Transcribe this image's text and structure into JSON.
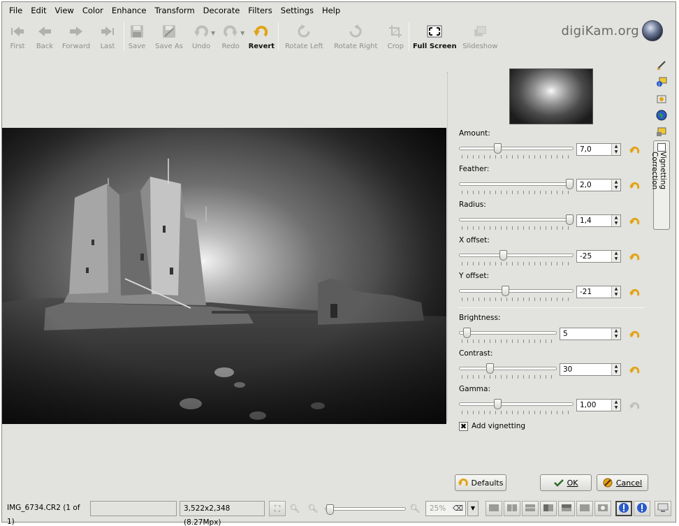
{
  "menu": [
    "File",
    "Edit",
    "View",
    "Color",
    "Enhance",
    "Transform",
    "Decorate",
    "Filters",
    "Settings",
    "Help"
  ],
  "toolbar": {
    "first": "First",
    "back": "Back",
    "forward": "Forward",
    "last": "Last",
    "save": "Save",
    "save_as": "Save As",
    "undo": "Undo",
    "redo": "Redo",
    "revert": "Revert",
    "rotate_left": "Rotate Left",
    "rotate_right": "Rotate Right",
    "crop": "Crop",
    "full_screen": "Full Screen",
    "slideshow": "Slideshow"
  },
  "brand": "digiKam.org",
  "controls": {
    "amount": {
      "label": "Amount:",
      "value": "7,0",
      "level": 0.33
    },
    "feather": {
      "label": "Feather:",
      "value": "2,0",
      "level": 1.0
    },
    "radius": {
      "label": "Radius:",
      "value": "1,4",
      "level": 1.0
    },
    "x_offset": {
      "label": "X offset:",
      "value": "-25",
      "level": 0.38
    },
    "y_offset": {
      "label": "Y offset:",
      "value": "-21",
      "level": 0.4
    },
    "brightness": {
      "label": "Brightness:",
      "value": "5",
      "level": 0.05
    },
    "contrast": {
      "label": "Contrast:",
      "value": "30",
      "level": 0.3
    },
    "gamma": {
      "label": "Gamma:",
      "value": "1,00",
      "level": 0.33
    }
  },
  "add_vignetting": {
    "label": "Add vignetting",
    "checked": true,
    "mark": "✖"
  },
  "side_tab": {
    "label": "Vignetting Correction"
  },
  "buttons": {
    "defaults": "Defaults",
    "ok": "OK",
    "cancel": "Cancel"
  },
  "status": {
    "filename": "IMG_6734.CR2 (1 of 1)",
    "dimensions": "3,522x2,348 (8.27Mpx)",
    "zoom": "25%",
    "zoom_level": 0.02
  },
  "colors": {
    "accent": "#e2a416",
    "window_bg": "#e2e2de",
    "info_blue": "#2a5cc8"
  }
}
